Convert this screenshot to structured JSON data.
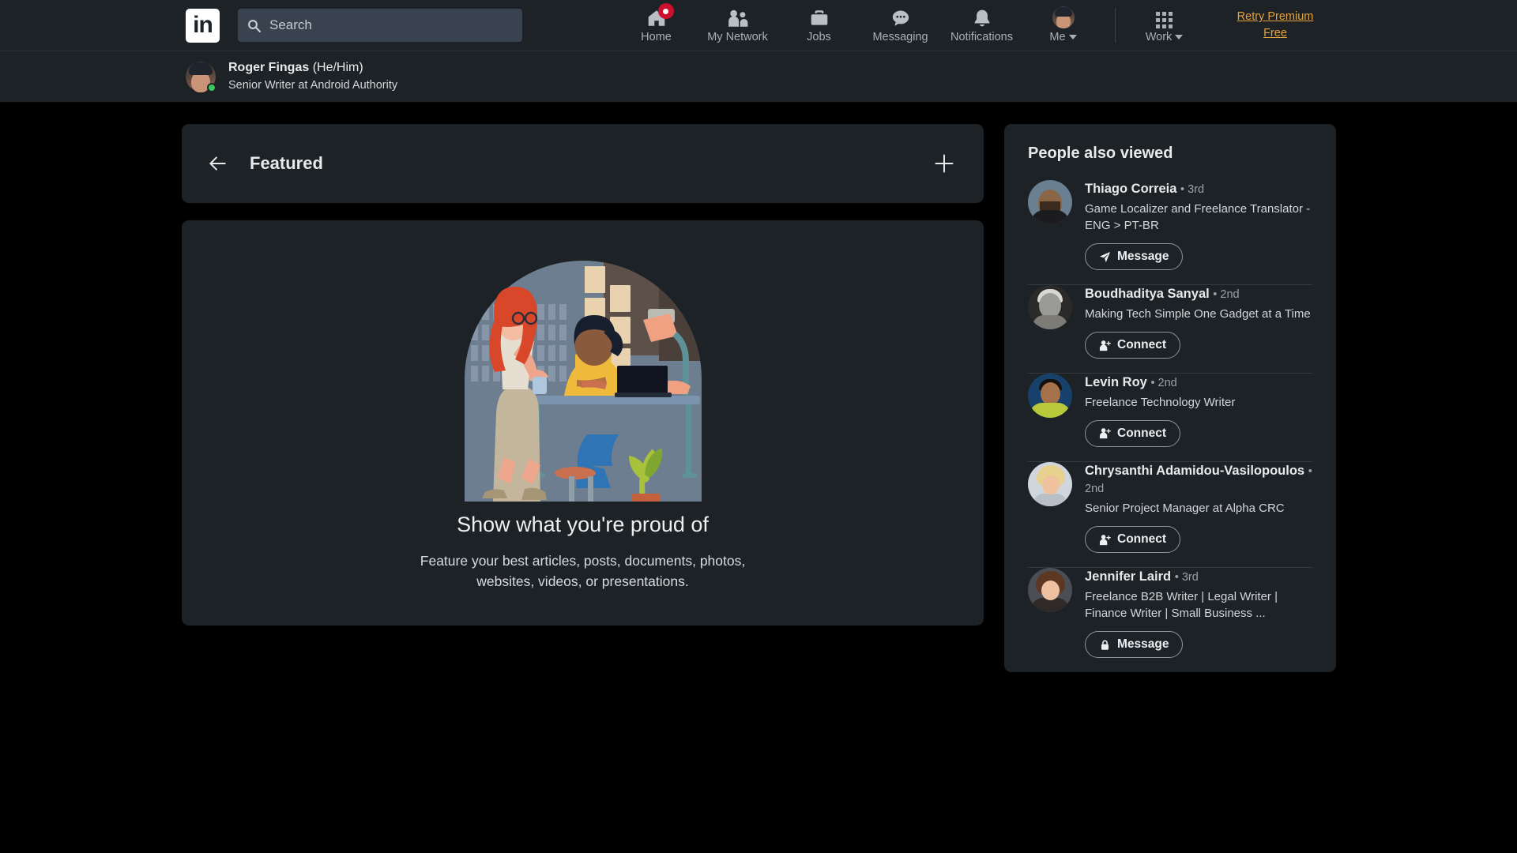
{
  "topnav": {
    "logo_text": "in",
    "logo_icon": "linkedin-logo",
    "search": {
      "icon": "search-icon",
      "placeholder": "Search",
      "value": ""
    },
    "items": [
      {
        "label": "Home",
        "icon": "home-icon",
        "badge": true
      },
      {
        "label": "My Network",
        "icon": "people-icon",
        "badge": false
      },
      {
        "label": "Jobs",
        "icon": "briefcase-icon",
        "badge": false
      },
      {
        "label": "Messaging",
        "icon": "message-bubble-icon",
        "badge": false
      },
      {
        "label": "Notifications",
        "icon": "bell-icon",
        "badge": false
      }
    ],
    "me": {
      "label": "Me",
      "icon": "avatar-icon",
      "caret": "chevron-down-icon"
    },
    "work": {
      "label": "Work",
      "icon": "grid-apps-icon",
      "caret": "chevron-down-icon"
    },
    "premium": {
      "line1": "Retry Premium",
      "line2": "Free",
      "color": "#e7a33e"
    }
  },
  "subheader": {
    "name": "Roger Fingas",
    "pronouns": "(He/Him)",
    "title": "Senior Writer at Android Authority",
    "avatar_icon": "avatar-icon",
    "presence": "online"
  },
  "featured": {
    "back_icon": "back-arrow-icon",
    "title": "Featured",
    "add_icon": "plus-icon",
    "illustration": "office-collaboration-illustration",
    "headline": "Show what you're proud of",
    "description": "Feature your best articles, posts, documents, photos, websites, videos, or presentations."
  },
  "sidebar": {
    "title": "People also viewed",
    "people": [
      {
        "name": "Thiago Correia",
        "degree": "• 3rd",
        "subtitle": "Game Localizer and Freelance Translator - ENG > PT-BR",
        "action": {
          "label": "Message",
          "icon": "send-icon"
        },
        "avatar_class": "av-a"
      },
      {
        "name": "Boudhaditya Sanyal",
        "degree": "• 2nd",
        "subtitle": "Making Tech Simple One Gadget at a Time",
        "action": {
          "label": "Connect",
          "icon": "person-add-icon"
        },
        "avatar_class": "av-b"
      },
      {
        "name": "Levin Roy",
        "degree": "• 2nd",
        "subtitle": "Freelance Technology Writer",
        "action": {
          "label": "Connect",
          "icon": "person-add-icon"
        },
        "avatar_class": "av-c"
      },
      {
        "name": "Chrysanthi Adamidou-Vasilopoulos",
        "degree": "• 2nd",
        "subtitle": "Senior Project Manager at Alpha CRC",
        "action": {
          "label": "Connect",
          "icon": "person-add-icon"
        },
        "avatar_class": "av-d"
      },
      {
        "name": "Jennifer Laird",
        "degree": "• 3rd",
        "subtitle": "Freelance B2B Writer | Legal Writer | Finance Writer | Small Business ...",
        "action": {
          "label": "Message",
          "icon": "lock-icon"
        },
        "avatar_class": "av-e"
      }
    ]
  }
}
